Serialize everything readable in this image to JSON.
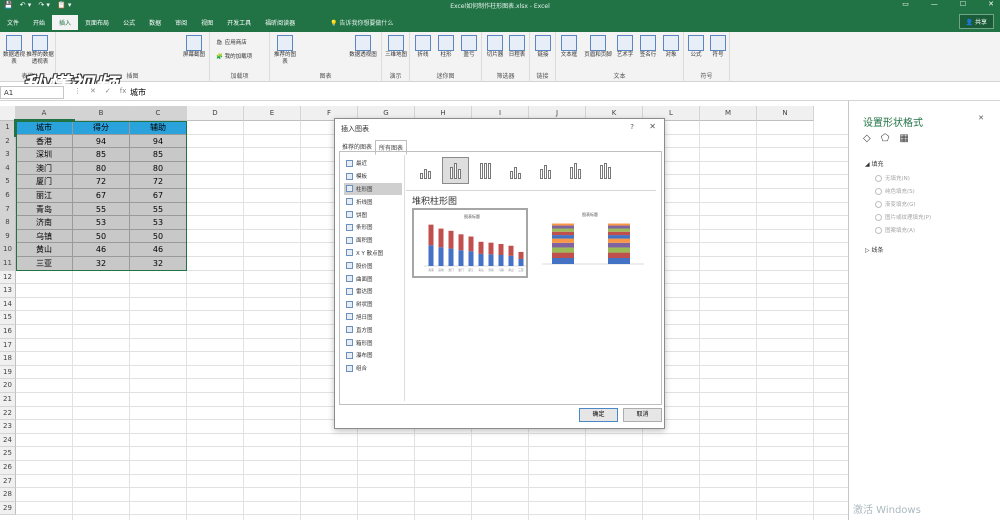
{
  "titlebar": {
    "doc_title": "Excel如何制作柱形图表.xlsx - Excel",
    "qat": [
      "💾",
      "↶ ▾",
      "↷ ▾",
      "📋 ▾"
    ],
    "win_buttons": [
      "▭",
      "—",
      "☐",
      "✕"
    ]
  },
  "ribbon_tabs": [
    "文件",
    "开始",
    "插入",
    "页面布局",
    "公式",
    "数据",
    "审阅",
    "视图",
    "开发工具",
    "福昕阅读器"
  ],
  "active_tab": "插入",
  "tell_me": "告诉我你想要做什么",
  "share_label": "共享",
  "ribbon": {
    "groups": [
      {
        "label": "表格",
        "buttons": [
          "数据透视表",
          "推荐的数据透视表"
        ]
      },
      {
        "label": "插图",
        "buttons": [
          "屏幕截图"
        ]
      },
      {
        "label": "加载项",
        "buttons": [
          "应用商店",
          "我的加载项"
        ]
      },
      {
        "label": "图表",
        "buttons": [
          "推荐的图表",
          "数据透视图"
        ]
      },
      {
        "label": "演示",
        "buttons": [
          "三维地图"
        ]
      },
      {
        "label": "迷你图",
        "buttons": [
          "折线",
          "柱形",
          "盈亏"
        ]
      },
      {
        "label": "筛选器",
        "buttons": [
          "切片器",
          "日程表"
        ]
      },
      {
        "label": "链接",
        "buttons": [
          "链接"
        ]
      },
      {
        "label": "文本",
        "buttons": [
          "文本框",
          "页眉和页脚",
          "艺术字",
          "签名行",
          "对象"
        ]
      },
      {
        "label": "符号",
        "buttons": [
          "公式",
          "符号"
        ]
      }
    ],
    "video_watermark": "秒懂视频"
  },
  "formula_bar": {
    "name_box": "A1",
    "icons": [
      "⋮",
      "✕",
      "✓",
      "fx"
    ],
    "content": "城市"
  },
  "columns": [
    "A",
    "B",
    "C",
    "D",
    "E",
    "F",
    "G",
    "H",
    "I",
    "J",
    "K",
    "L",
    "M",
    "N"
  ],
  "rows": [
    "1",
    "2",
    "3",
    "4",
    "5",
    "6",
    "7",
    "8",
    "9",
    "10",
    "11",
    "12",
    "13",
    "14",
    "15",
    "16",
    "17",
    "18",
    "19",
    "20",
    "21",
    "22",
    "23",
    "24",
    "25",
    "26",
    "27",
    "28",
    "29"
  ],
  "table": {
    "headers": [
      "城市",
      "得分",
      "辅助"
    ],
    "rows": [
      [
        "香港",
        "94",
        "94"
      ],
      [
        "深圳",
        "85",
        "85"
      ],
      [
        "澳门",
        "80",
        "80"
      ],
      [
        "厦门",
        "72",
        "72"
      ],
      [
        "丽江",
        "67",
        "67"
      ],
      [
        "青岛",
        "55",
        "55"
      ],
      [
        "济南",
        "53",
        "53"
      ],
      [
        "乌镇",
        "50",
        "50"
      ],
      [
        "黄山",
        "46",
        "46"
      ],
      [
        "三亚",
        "32",
        "32"
      ]
    ]
  },
  "task_pane": {
    "title": "设置形状格式",
    "close": "✕",
    "icons": [
      "◇",
      "⬠",
      "▦"
    ],
    "fill_section": "◢ 填充",
    "fill_options": [
      "无填充(N)",
      "纯色填充(S)",
      "渐变填充(G)",
      "图片或纹理填充(P)",
      "图案填充(A)"
    ],
    "line_section": "▷ 线条",
    "activate_windows": "激活 Windows"
  },
  "dialog": {
    "title": "插入图表",
    "help": "?",
    "close": "✕",
    "tabs": [
      "推荐的图表",
      "所有图表"
    ],
    "active_tab": "所有图表",
    "chart_types": [
      "最近",
      "模板",
      "柱形图",
      "折线图",
      "饼图",
      "条形图",
      "面积图",
      "X Y 散点图",
      "股价图",
      "曲面图",
      "雷达图",
      "树状图",
      "旭日图",
      "直方图",
      "箱形图",
      "瀑布图",
      "组合"
    ],
    "active_type": "柱形图",
    "selected_subtype_title": "堆积柱形图",
    "preview_title": "图表标题",
    "ok_label": "确定",
    "cancel_label": "取消",
    "colors": {
      "series1": "#4472c4",
      "series2": "#c0504d",
      "band_a": "#f79646",
      "band_b": "#9bbb59",
      "band_c": "#8064a2"
    }
  },
  "chart_data": [
    {
      "type": "bar",
      "title": "图表标题",
      "stacked": true,
      "categories": [
        "香港",
        "深圳",
        "澳门",
        "厦门",
        "丽江",
        "青岛",
        "济南",
        "乌镇",
        "黄山",
        "三亚"
      ],
      "series": [
        {
          "values": [
            94,
            85,
            80,
            72,
            67,
            55,
            53,
            50,
            46,
            32
          ]
        },
        {
          "values": [
            94,
            85,
            80,
            72,
            67,
            55,
            53,
            50,
            46,
            32
          ]
        }
      ]
    }
  ]
}
